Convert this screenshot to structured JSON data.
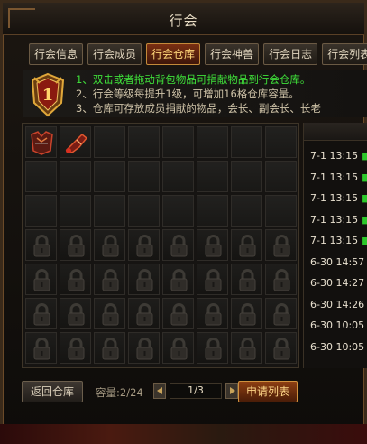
{
  "window": {
    "title": "行会"
  },
  "tabs": [
    {
      "label": "行会信息",
      "active": false
    },
    {
      "label": "行会成员",
      "active": false
    },
    {
      "label": "行会仓库",
      "active": true
    },
    {
      "label": "行会神兽",
      "active": false
    },
    {
      "label": "行会日志",
      "active": false
    },
    {
      "label": "行会列表",
      "active": false
    }
  ],
  "notice": {
    "badge_level": "1",
    "lines": [
      "1、双击或者拖动背包物品可捐献物品到行会仓库。",
      "2、行会等级每提升1级，可增加16格仓库容量。",
      "3、仓库可存放成员捐献的物品，会长、副会长、长老"
    ]
  },
  "storage": {
    "columns": 8,
    "rows": 7,
    "unlocked_rows": 3,
    "items": [
      "armor-item",
      "gauntlet-item"
    ]
  },
  "log": {
    "entries": [
      "7-1 13:15",
      "7-1 13:15",
      "7-1 13:15",
      "7-1 13:15",
      "7-1 13:15",
      "6-30 14:57",
      "6-30 14:27",
      "6-30 14:26",
      "6-30 10:05",
      "6-30 10:05"
    ]
  },
  "footer": {
    "back_label": "返回仓库",
    "capacity": "容量:2/24",
    "page": "1/3",
    "apply_label": "申请列表"
  },
  "colors": {
    "accent": "#c48a3a",
    "notice_green": "#3fe03a"
  }
}
